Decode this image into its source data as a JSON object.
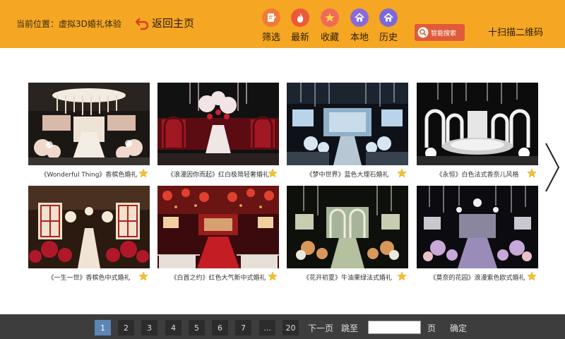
{
  "header": {
    "location": "当前位置：虚拟3D婚礼体验",
    "back_label": "返回主页",
    "nav": [
      {
        "label": "筛选",
        "icon": "filter-note-icon",
        "color": "#f07a3a"
      },
      {
        "label": "最新",
        "icon": "flame-icon",
        "color": "#ec5a3a"
      },
      {
        "label": "收藏",
        "icon": "star-icon",
        "color": "#f06a5a"
      },
      {
        "label": "本地",
        "icon": "home-icon",
        "color": "#8a6ad8"
      },
      {
        "label": "历史",
        "icon": "home-history-icon",
        "color": "#7a6ad8"
      }
    ],
    "search_label": "智能搜索",
    "scan_label": "十扫描二维码"
  },
  "cards": [
    {
      "title": "《Wonderful Thing》香槟色婚礼"
    },
    {
      "title": "《浪漫因你而起》红白极简轻奢婚礼"
    },
    {
      "title": "《梦中世界》蓝色大理石婚礼"
    },
    {
      "title": "《永恒》白色法式香奈儿风格"
    },
    {
      "title": "《一生一世》香槟色中式婚礼"
    },
    {
      "title": "《白首之约》红色大气新中式婚礼"
    },
    {
      "title": "《花开初夏》牛油果绿法式婚礼"
    },
    {
      "title": "《莫奈的花园》浪漫紫色欧式婚礼"
    }
  ],
  "pagination": {
    "pages": [
      "1",
      "2",
      "3",
      "4",
      "5",
      "6",
      "7",
      "...",
      "20"
    ],
    "current": "1",
    "next_label": "下一页",
    "jump_label": "跳至",
    "jump_value": "",
    "page_suffix": "页",
    "confirm_label": "确定"
  },
  "colors": {
    "header_bg": "#f5a623",
    "footer_bg": "#3d3d3d",
    "active_page": "#5b86b5",
    "search_bg": "#e05a3a",
    "star": "#f2c12e"
  }
}
